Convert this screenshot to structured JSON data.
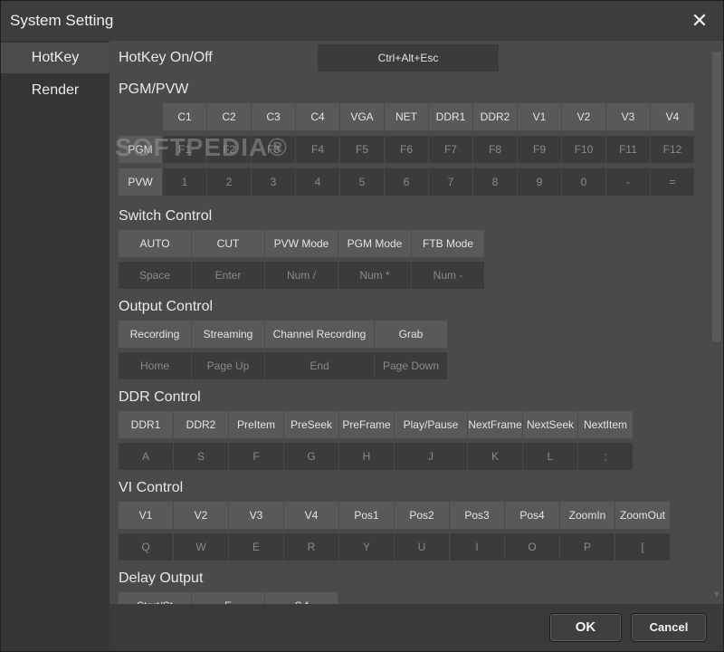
{
  "window": {
    "title": "System Setting"
  },
  "sidebar": {
    "items": [
      {
        "label": "HotKey"
      },
      {
        "label": "Render"
      }
    ]
  },
  "hotkey_onoff": {
    "title": "HotKey On/Off",
    "value": "Ctrl+Alt+Esc"
  },
  "pgm_pvw": {
    "title": "PGM/PVW",
    "headers": [
      "C1",
      "C2",
      "C3",
      "C4",
      "VGA",
      "NET",
      "DDR1",
      "DDR2",
      "V1",
      "V2",
      "V3",
      "V4"
    ],
    "rows": [
      {
        "label": "PGM",
        "keys": [
          "F1",
          "F2",
          "F3",
          "F4",
          "F5",
          "F6",
          "F7",
          "F8",
          "F9",
          "F10",
          "F11",
          "F12"
        ]
      },
      {
        "label": "PVW",
        "keys": [
          "1",
          "2",
          "3",
          "4",
          "5",
          "6",
          "7",
          "8",
          "9",
          "0",
          "-",
          "="
        ]
      }
    ]
  },
  "switch_control": {
    "title": "Switch Control",
    "actions": [
      "AUTO",
      "CUT",
      "PVW Mode",
      "PGM Mode",
      "FTB Mode"
    ],
    "keys": [
      "Space",
      "Enter",
      "Num /",
      "Num *",
      "Num -"
    ]
  },
  "output_control": {
    "title": "Output Control",
    "actions": [
      "Recording",
      "Streaming",
      "Channel Recording",
      "Grab"
    ],
    "keys": [
      "Home",
      "Page Up",
      "End",
      "Page Down"
    ]
  },
  "ddr_control": {
    "title": "DDR Control",
    "actions": [
      "DDR1",
      "DDR2",
      "PreItem",
      "PreSeek",
      "PreFrame",
      "Play/Pause",
      "NextFrame",
      "NextSeek",
      "NextItem"
    ],
    "keys": [
      "A",
      "S",
      "F",
      "G",
      "H",
      "J",
      "K",
      "L",
      ";"
    ]
  },
  "vi_control": {
    "title": "VI Control",
    "actions": [
      "V1",
      "V2",
      "V3",
      "V4",
      "Pos1",
      "Pos2",
      "Pos3",
      "Pos4",
      "ZoomIn",
      "ZoomOut"
    ],
    "keys": [
      "Q",
      "W",
      "E",
      "R",
      "Y",
      "U",
      "I",
      "O",
      "P",
      "["
    ]
  },
  "delay_output": {
    "title": "Delay Output",
    "actions": [
      "Start/St",
      "E",
      "S f"
    ]
  },
  "watermark": "SOFTPEDIA®",
  "footer": {
    "ok": "OK",
    "cancel": "Cancel"
  }
}
